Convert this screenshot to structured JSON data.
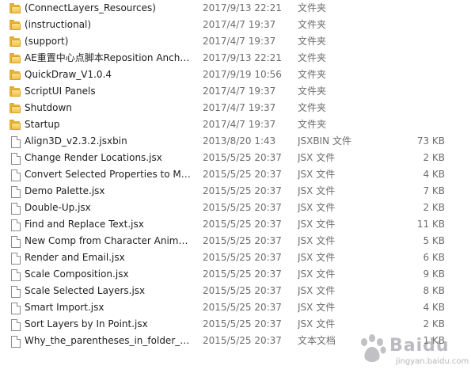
{
  "files": [
    {
      "icon": "folder-icon",
      "name": "(ConnectLayers_Resources)",
      "date": "2017/9/13 22:21",
      "type": "文件夹",
      "size": ""
    },
    {
      "icon": "folder-icon",
      "name": "(instructional)",
      "date": "2017/4/7 19:37",
      "type": "文件夹",
      "size": ""
    },
    {
      "icon": "folder-icon",
      "name": "(support)",
      "date": "2017/4/7 19:37",
      "type": "文件夹",
      "size": ""
    },
    {
      "icon": "folder-icon",
      "name": "AE重置中心点脚本Reposition Ancho...",
      "date": "2017/9/13 22:21",
      "type": "文件夹",
      "size": ""
    },
    {
      "icon": "folder-icon",
      "name": "QuickDraw_V1.0.4",
      "date": "2017/9/19 10:56",
      "type": "文件夹",
      "size": ""
    },
    {
      "icon": "folder-icon",
      "name": "ScriptUI Panels",
      "date": "2017/4/7 19:37",
      "type": "文件夹",
      "size": ""
    },
    {
      "icon": "folder-icon",
      "name": "Shutdown",
      "date": "2017/4/7 19:37",
      "type": "文件夹",
      "size": ""
    },
    {
      "icon": "folder-icon",
      "name": "Startup",
      "date": "2017/4/7 19:37",
      "type": "文件夹",
      "size": ""
    },
    {
      "icon": "file-icon",
      "name": "Align3D_v2.3.2.jsxbin",
      "date": "2013/8/20 1:43",
      "type": "JSXBIN 文件",
      "size": "73 KB"
    },
    {
      "icon": "file-icon",
      "name": "Change Render Locations.jsx",
      "date": "2015/5/25 20:37",
      "type": "JSX 文件",
      "size": "2 KB"
    },
    {
      "icon": "file-icon",
      "name": "Convert Selected Properties to Ma...",
      "date": "2015/5/25 20:37",
      "type": "JSX 文件",
      "size": "4 KB"
    },
    {
      "icon": "file-icon",
      "name": "Demo Palette.jsx",
      "date": "2015/5/25 20:37",
      "type": "JSX 文件",
      "size": "7 KB"
    },
    {
      "icon": "file-icon",
      "name": "Double-Up.jsx",
      "date": "2015/5/25 20:37",
      "type": "JSX 文件",
      "size": "2 KB"
    },
    {
      "icon": "file-icon",
      "name": "Find and Replace Text.jsx",
      "date": "2015/5/25 20:37",
      "type": "JSX 文件",
      "size": "11 KB"
    },
    {
      "icon": "file-icon",
      "name": "New Comp from Character Animat...",
      "date": "2015/5/25 20:37",
      "type": "JSX 文件",
      "size": "5 KB"
    },
    {
      "icon": "file-icon",
      "name": "Render and Email.jsx",
      "date": "2015/5/25 20:37",
      "type": "JSX 文件",
      "size": "6 KB"
    },
    {
      "icon": "file-icon",
      "name": "Scale Composition.jsx",
      "date": "2015/5/25 20:37",
      "type": "JSX 文件",
      "size": "9 KB"
    },
    {
      "icon": "file-icon",
      "name": "Scale Selected Layers.jsx",
      "date": "2015/5/25 20:37",
      "type": "JSX 文件",
      "size": "8 KB"
    },
    {
      "icon": "file-icon",
      "name": "Smart Import.jsx",
      "date": "2015/5/25 20:37",
      "type": "JSX 文件",
      "size": "4 KB"
    },
    {
      "icon": "file-icon",
      "name": "Sort Layers by In Point.jsx",
      "date": "2015/5/25 20:37",
      "type": "JSX 文件",
      "size": "2 KB"
    },
    {
      "icon": "file-icon",
      "name": "Why_the_parentheses_in_folder_na...",
      "date": "2015/5/25 20:37",
      "type": "文本文档",
      "size": "1 KB"
    }
  ],
  "watermark": {
    "text": "Baidu",
    "sub": "jingyan.baidu.com"
  }
}
